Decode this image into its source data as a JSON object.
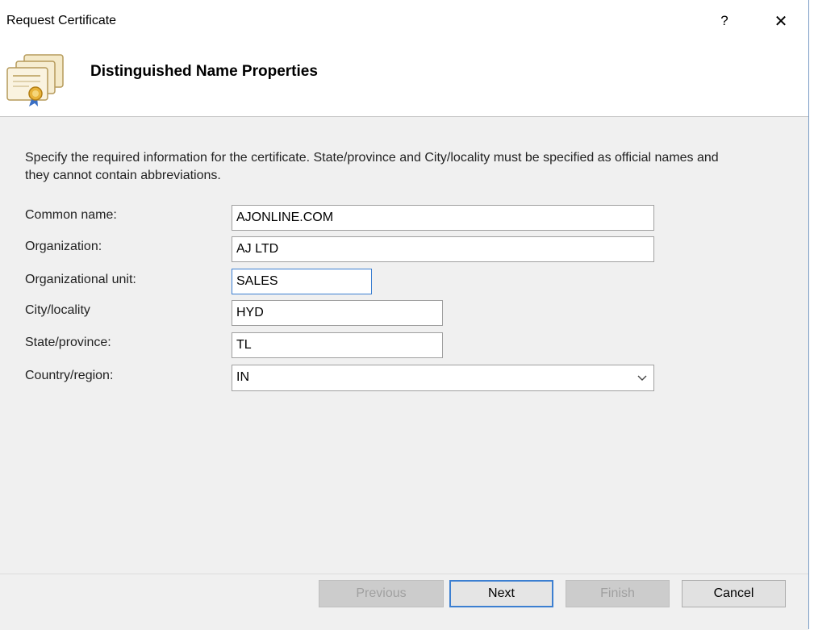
{
  "window": {
    "title": "Request Certificate",
    "help_symbol": "?",
    "close_symbol": "✕"
  },
  "header": {
    "title": "Distinguished Name Properties",
    "icon": "certificate-icon"
  },
  "description": "Specify the required information for the certificate. State/province and City/locality must be specified as official names and they cannot contain abbreviations.",
  "fields": {
    "common_name": {
      "label": "Common name:",
      "value": "AJONLINE.COM"
    },
    "organization": {
      "label": "Organization:",
      "value": "AJ LTD"
    },
    "organizational_unit": {
      "label": "Organizational unit:",
      "value": "SALES"
    },
    "city": {
      "label": "City/locality",
      "value": "HYD"
    },
    "state": {
      "label": "State/province:",
      "value": "TL"
    },
    "country": {
      "label": "Country/region:",
      "value": "IN"
    }
  },
  "buttons": {
    "previous": "Previous",
    "next": "Next",
    "finish": "Finish",
    "cancel": "Cancel"
  },
  "colors": {
    "accent": "#3c7fd1",
    "content_bg": "#f0f0f0"
  }
}
